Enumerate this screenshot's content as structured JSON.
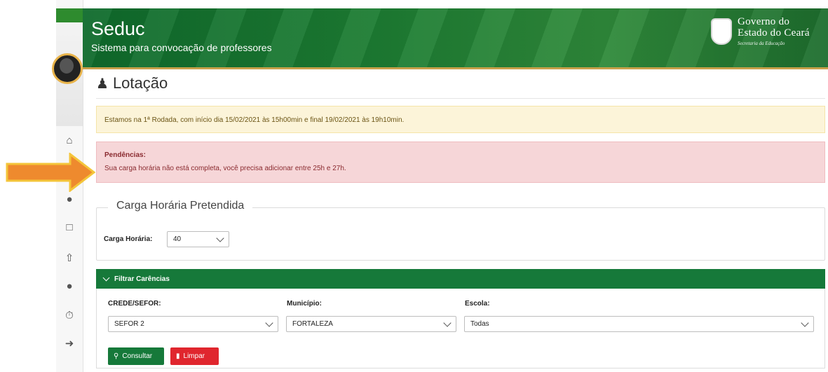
{
  "header": {
    "app_title": "Seduc",
    "app_subtitle": "Sistema para convocação de professores",
    "gov_line1": "Governo do",
    "gov_line2": "Estado do Ceará",
    "gov_line3": "Secretaria da Educação"
  },
  "sidebar": {
    "icons": [
      "home-icon",
      "user-circle-icon",
      "bank-icon",
      "upload-icon",
      "users-icon",
      "clock-icon",
      "sign-out-icon"
    ]
  },
  "page": {
    "title": "Lotação",
    "info_alert": "Estamos na 1ª Rodada, com início dia 15/02/2021 às 15h00min e final 19/02/2021 às 19h10min.",
    "pending_title": "Pendências:",
    "pending_text": "Sua carga horária não está completa, você precisa adicionar entre 25h e 27h."
  },
  "carga": {
    "legend": "Carga Horária Pretendida",
    "label": "Carga Horária:",
    "value": "40"
  },
  "filter": {
    "panel_title": "Filtrar Carências",
    "crede_label": "CREDE/SEFOR:",
    "crede_value": "SEFOR 2",
    "municipio_label": "Município:",
    "municipio_value": "FORTALEZA",
    "escola_label": "Escola:",
    "escola_value": "Todas",
    "consultar_label": "Consultar",
    "limpar_label": "Limpar"
  },
  "colors": {
    "brand_green": "#16793a",
    "arrow_orange": "#ee8a2e",
    "danger_red": "#e0262e"
  }
}
